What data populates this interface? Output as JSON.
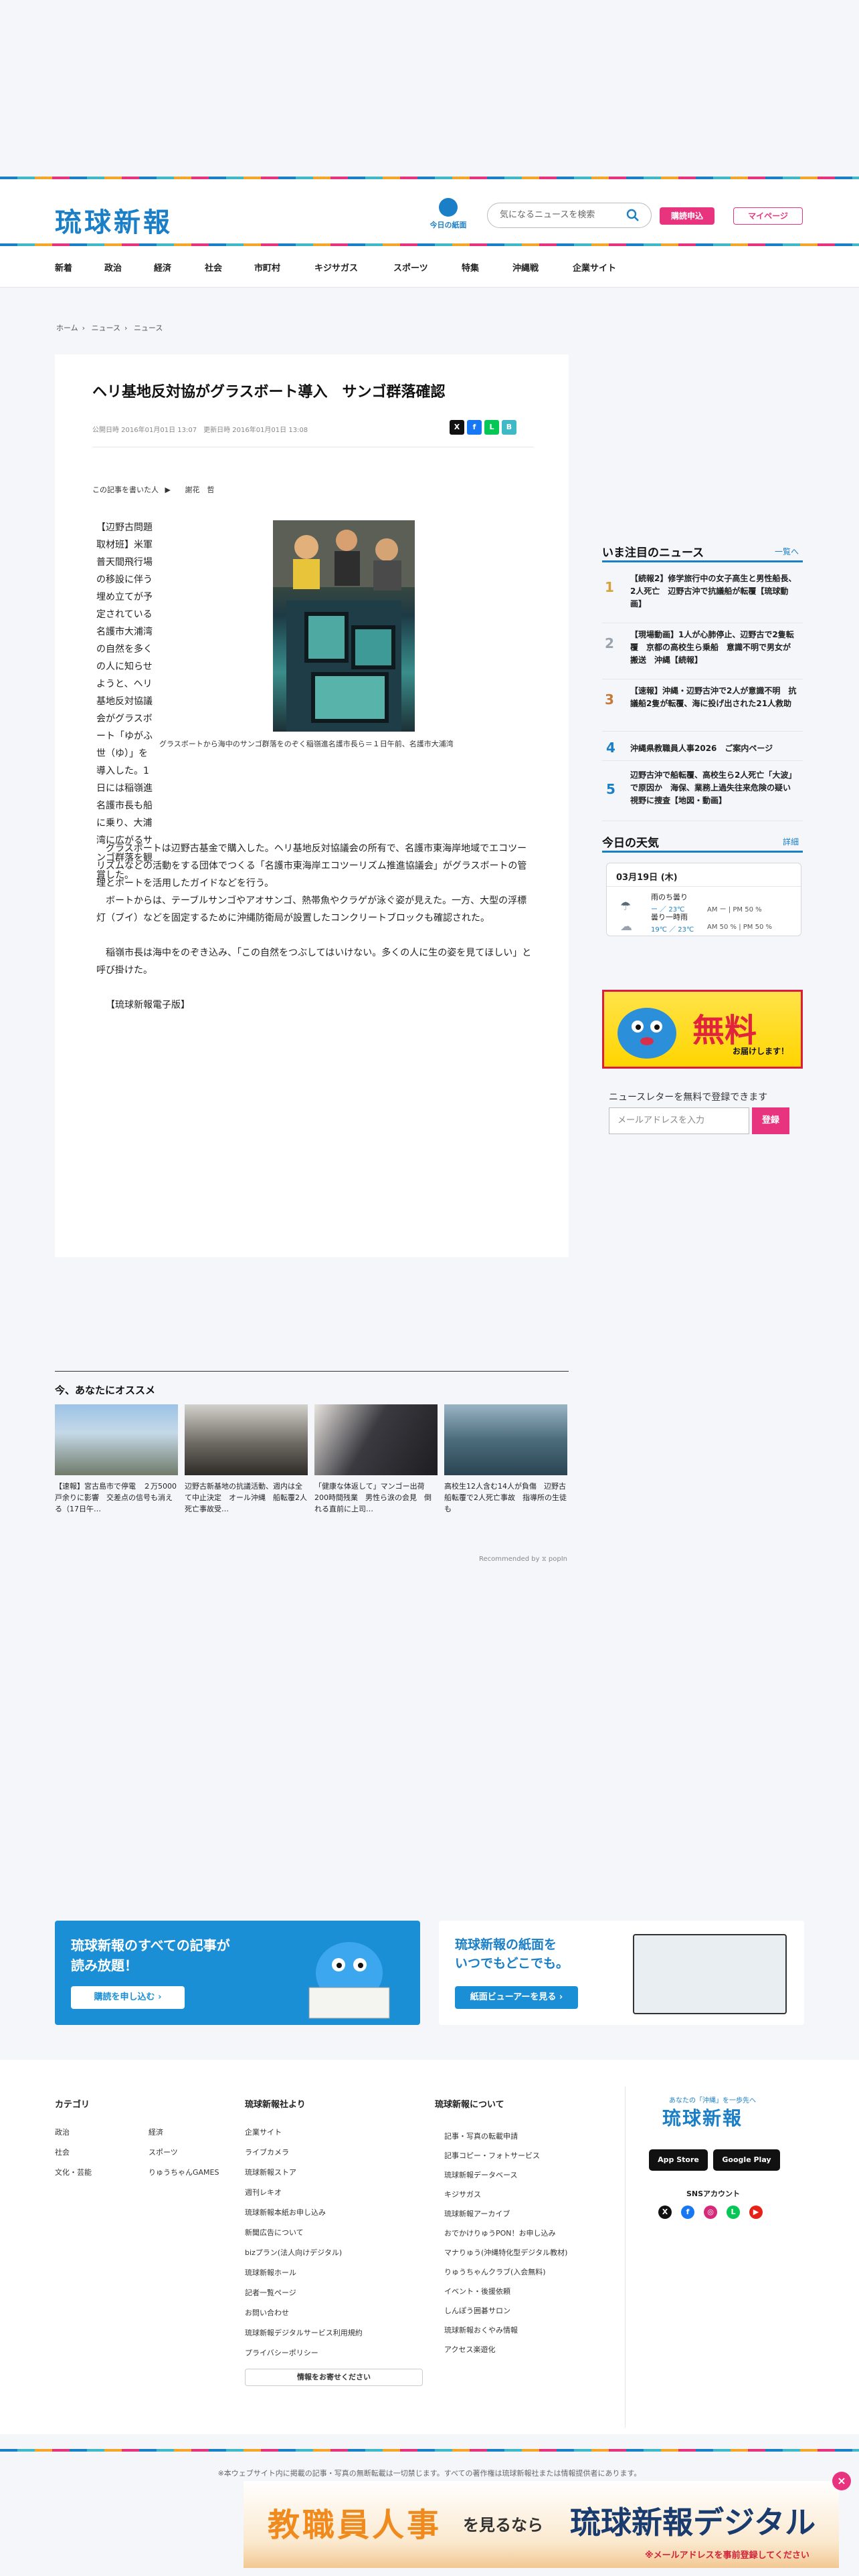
{
  "header": {
    "logo": "琉球新報",
    "todays_paper_label": "今日の紙面",
    "search_placeholder": "気になるニュースを検索",
    "subscribe_label": "購読申込",
    "mypage_label": "マイページ"
  },
  "nav": [
    "新着",
    "政治",
    "経済",
    "社会",
    "市町村",
    "キジサガス",
    "スポーツ",
    "特集",
    "沖縄戦",
    "企業サイト"
  ],
  "breadcrumb": [
    "ホーム",
    "ニュース",
    "ニュース"
  ],
  "article": {
    "title": "ヘリ基地反対協がグラスボート導入　サンゴ群落確認",
    "published": "公開日時 2016年01月01日 13:07　更新日時 2016年01月01日 13:08",
    "author_label": "この記事を書いた人",
    "author_name": "謝花　哲",
    "lead": "【辺野古問題取材班】米軍普天間飛行場の移設に伴う埋め立てが予定されている名護市大浦湾の自然を多くの人に知らせようと、ヘリ基地反対協議会がグラスボート「ゆがふ世（ゆ）」を導入した。1日には稲嶺進名護市長も船に乗り、大浦湾に広がるサンゴ群落を観賞した。",
    "photo_caption": "グラスボートから海中のサンゴ群落をのぞく稲嶺進名護市長ら＝１日午前、名護市大浦湾",
    "para1": "グラスボートは辺野古基金で購入した。ヘリ基地反対協議会の所有で、名護市東海岸地域でエコツーリズムなどの活動をする団体でつくる「名護市東海岸エコツーリズム推進協議会」がグラスボートの管理とボートを活用したガイドなどを行う。",
    "para2": "ボートからは、テーブルサンゴやアオサンゴ、熱帯魚やクラゲが泳ぐ姿が見えた。一方、大型の浮標灯（ブイ）などを固定するために沖縄防衛局が設置したコンクリートブロックも確認された。",
    "para3": "稲嶺市長は海中をのぞき込み、「この自然をつぶしてはいけない。多くの人に生の姿を見てほしい」と呼び掛けた。",
    "credit": "【琉球新報電子版】"
  },
  "sidebar": {
    "ranking_title": "いま注目のニュース",
    "ranking_more": "一覧へ",
    "ranking": [
      {
        "rank": "1",
        "text": "【続報2】修学旅行中の女子高生と男性船長、2人死亡　辺野古沖で抗議船が転覆【琉球動画】"
      },
      {
        "rank": "2",
        "text": "【現場動画】1人が心肺停止、辺野古で2隻転覆　京都の高校生ら乗船　意識不明で男女が搬送　沖縄【続報】"
      },
      {
        "rank": "3",
        "text": "【速報】沖縄・辺野古沖で2人が意識不明　抗議船2隻が転覆、海に投げ出された21人救助"
      },
      {
        "rank": "4",
        "text": "沖縄県教職員人事2026　ご案内ページ"
      },
      {
        "rank": "5",
        "text": "辺野古沖で船転覆、高校生ら2人死亡「大波」で原因か　海保、業務上過失往来危険の疑い視野に捜査【地図・動画】"
      }
    ],
    "weather_title": "今日の天気",
    "weather_more": "詳細",
    "weather": {
      "date": "03月19日 (木)",
      "today_label": "雨のち曇り",
      "today_temp": "ー ／ 23℃",
      "today_rain": "AM ー | PM 50 %",
      "tomorrow_label": "曇り一時雨",
      "tomorrow_temp": "19℃ ／ 23℃",
      "tomorrow_rain": "AM 50 % | PM 50 %"
    },
    "ad_text": "無料",
    "ad_sub": "お届けします！",
    "newsletter_label": "ニュースレターを無料で登録できます",
    "newsletter_placeholder": "メールアドレスを入力",
    "newsletter_button": "登録"
  },
  "recommend": {
    "title": "今、あなたにオススメ",
    "items": [
      "【速報】宮古島市で停電　２万5000戸余りに影響　交差点の信号も消える（17日午…",
      "辺野古新基地の抗議活動、週内は全て中止決定　オール沖縄　船転覆2人死亡事故受…",
      "「健康な体返して」マンゴー出荷200時間残業　男性ら涙の会見　倒れる直前に上司…",
      "高校生12人含む14人が負傷　辺野古船転覆で2人死亡事故　指導所の生徒も"
    ],
    "powered_by": "Recommended by ⧖ popIn"
  },
  "promo": {
    "left_title": "琉球新報のすべての記事が\n読み放題！",
    "left_button": "購読を申し込む ›",
    "right_title": "琉球新報の紙面を\nいつでもどこでも。",
    "right_button": "紙面ビューアーを見る ›"
  },
  "footer": {
    "col1_title": "カテゴリ",
    "col1_links": [
      "政治",
      "経済",
      "社会",
      "スポーツ",
      "文化・芸能",
      "りゅうちゃんGAMES"
    ],
    "col2_title": "琉球新報社より",
    "col2_links": [
      "企業サイト",
      "ライブカメラ",
      "琉球新報ストア",
      "週刊レキオ",
      "琉球新報本紙お申し込み",
      "新聞広告について",
      "bizプラン(法人向けデジタル)",
      "琉球新報ホール",
      "記者一覧ページ",
      "お問い合わせ",
      "琉球新報デジタルサービス利用規約",
      "プライバシーポリシー"
    ],
    "col2_button": "情報をお寄せください",
    "col3_title": "琉球新報について",
    "col3_links": [
      "記事・写真の転載申請",
      "記事コピー・フォトサービス",
      "琉球新報データベース",
      "キジサガス",
      "琉球新報アーカイブ",
      "おでかけりゅうPON！お申し込み",
      "マナりゅう(沖縄特化型デジタル教材)",
      "りゅうちゃんクラブ(入会無料)",
      "イベント・後援依頼",
      "しんぽう囲碁サロン",
      "琉球新報おくやみ情報",
      "アクセス楽遊化"
    ],
    "tagline": "あなたの「沖縄」を一歩先へ",
    "logo": "琉球新報",
    "app_store": "App Store",
    "google_play": "Google Play",
    "sns_label": "SNSアカウント",
    "copyright": "※本ウェブサイト内に掲載の記事・写真の無断転載は一切禁じます。すべての著作権は琉球新報社または情報提供者にあります。"
  },
  "bottom_ad": {
    "main": "教職員人事",
    "middle": "を見るなら",
    "brand": "琉球新報デジタル",
    "sub": "※メールアドレスを事前登録してください"
  },
  "colors": {
    "brand": "#1a7fc7",
    "accent": "#e8347f"
  }
}
